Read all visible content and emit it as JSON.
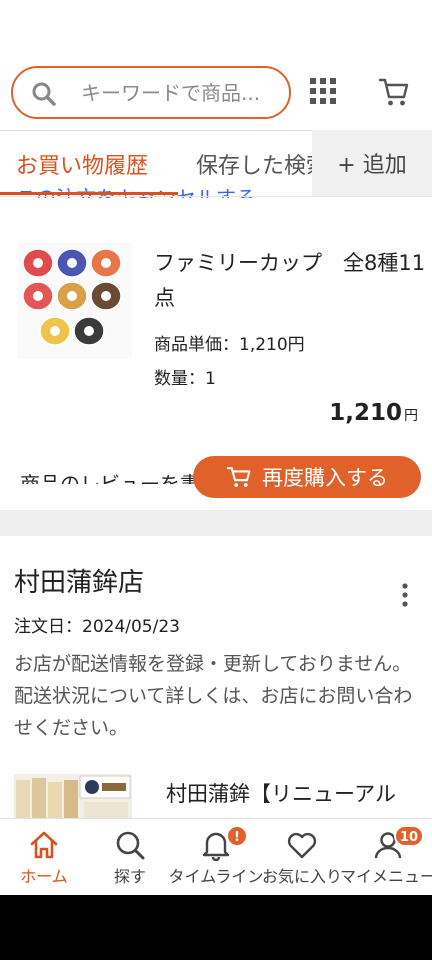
{
  "search": {
    "placeholder": "キーワードで商品..."
  },
  "tabs": [
    {
      "label": "お買い物履歴"
    },
    {
      "label": "保存した検索"
    }
  ],
  "add_tab_label": "+ 追加",
  "cutoff_link_text": "この注文をキャンセルする",
  "product": {
    "name": "ファミリーカップ　全8種11点",
    "unit_price": "商品単価：1,210円",
    "quantity": "数量：1",
    "total": "1,210",
    "total_unit": "円"
  },
  "review_cutoff_text": "商品のレビューを書く",
  "rebuy_label": "再度購入する",
  "store": {
    "name": "村田蒲鉾店",
    "order_date": "注文日：2024/05/23",
    "notice": "お店が配送情報を登録・更新しておりません。配送状況について詳しくは、お店にお問い合わせください。",
    "product_name": "村田蒲鉾【リニューアル"
  },
  "nav": [
    {
      "label": "ホーム",
      "icon": "home-icon"
    },
    {
      "label": "探す",
      "icon": "search-icon"
    },
    {
      "label": "タイムライン",
      "icon": "bell-icon",
      "badge": "!"
    },
    {
      "label": "お気に入り",
      "icon": "heart-icon"
    },
    {
      "label": "マイメニュー",
      "icon": "person-icon",
      "badge": "10"
    }
  ],
  "colors": {
    "accent": "#e0612a",
    "link": "#3a67d8"
  }
}
